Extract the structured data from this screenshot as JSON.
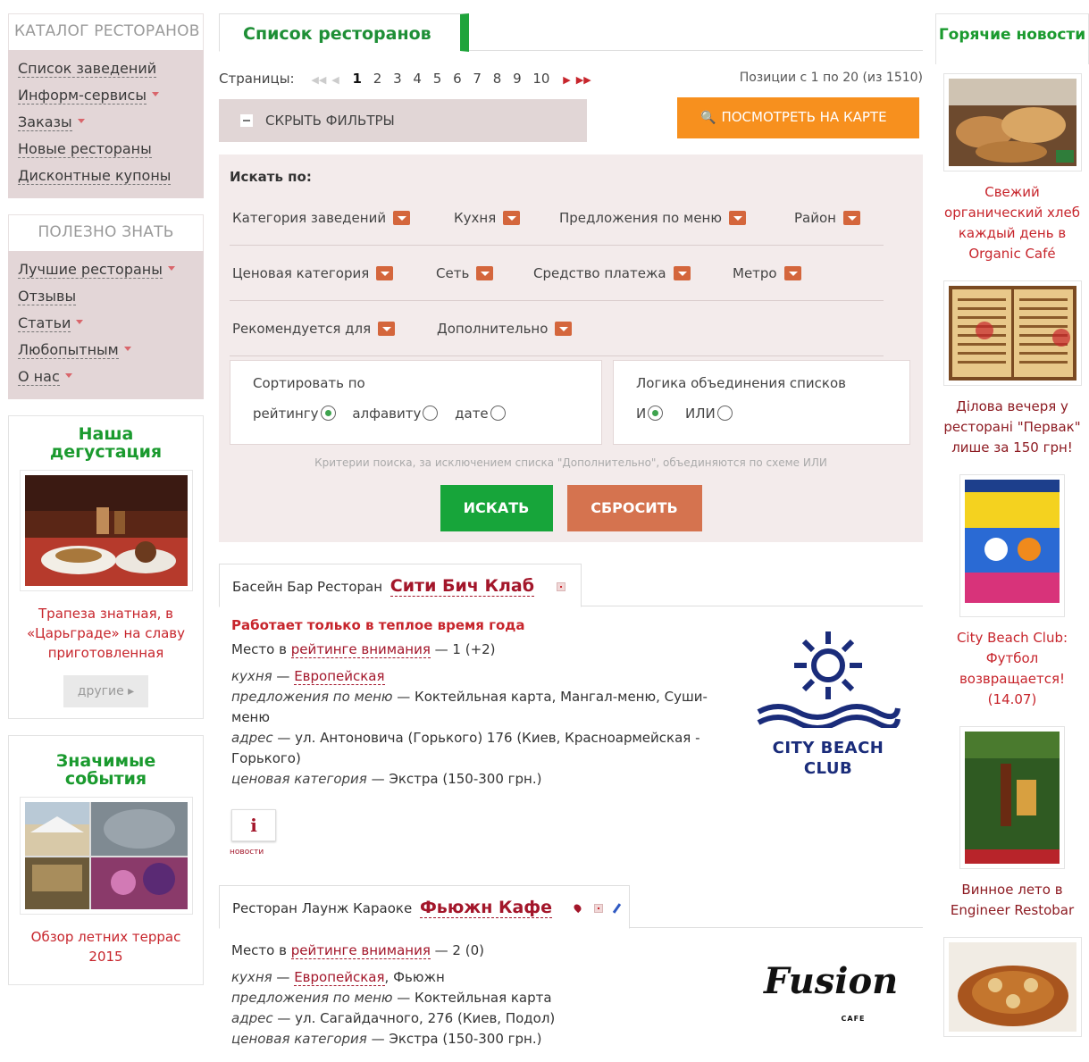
{
  "colors": {
    "accent_green": "#1fa43b",
    "brand_red": "#a3162a",
    "map_orange": "#f7901e",
    "reset_orange": "#d5734f",
    "menu_bg": "#e3d6d7"
  },
  "catalog": {
    "title": "КАТАЛОГ РЕСТОРАНОВ",
    "items": [
      {
        "label": "Список заведений",
        "has_menu": false
      },
      {
        "label": "Информ-сервисы",
        "has_menu": true
      },
      {
        "label": "Заказы",
        "has_menu": true
      },
      {
        "label": "Новые рестораны",
        "has_menu": false
      },
      {
        "label": "Дисконтные купоны",
        "has_menu": false
      }
    ]
  },
  "useful": {
    "title": "ПОЛЕЗНО ЗНАТЬ",
    "items": [
      {
        "label": "Лучшие рестораны",
        "has_menu": true
      },
      {
        "label": "Отзывы",
        "has_menu": false
      },
      {
        "label": "Статьи",
        "has_menu": true
      },
      {
        "label": "Любопытным",
        "has_menu": true
      },
      {
        "label": "О нас",
        "has_menu": true
      }
    ]
  },
  "tasting": {
    "title": "Наша дегустация",
    "caption": "Трапеза знатная, в «Царьграде» на славу приготовленная",
    "others_label": "другие"
  },
  "events": {
    "title": "Значимые события",
    "caption": "Обзор летних террас 2015"
  },
  "main": {
    "tab_title": "Список ресторанов",
    "pager": {
      "label": "Страницы:",
      "pages": [
        "1",
        "2",
        "3",
        "4",
        "5",
        "6",
        "7",
        "8",
        "9",
        "10"
      ],
      "current": "1",
      "positions": "Позиции с 1 по 20 (из 1510)"
    },
    "hide_filters_label": "СКРЫТЬ ФИЛЬТРЫ",
    "map_button_label": "ПОСМОТРЕТЬ НА КАРТЕ",
    "search_by_label": "Искать по:",
    "filter_rows": [
      [
        "Категория заведений",
        "Кухня",
        "Предложения по меню",
        "Район"
      ],
      [
        "Ценовая категория",
        "Сеть",
        "Средство платежа",
        "Метро"
      ],
      [
        "Рекомендуется для",
        "Дополнительно"
      ]
    ],
    "sort": {
      "title": "Сортировать по",
      "options": [
        {
          "label": "рейтингу",
          "selected": true
        },
        {
          "label": "алфавиту",
          "selected": false
        },
        {
          "label": "дате",
          "selected": false
        }
      ]
    },
    "logic": {
      "title": "Логика объединения списков",
      "options": [
        {
          "label": "И",
          "selected": true
        },
        {
          "label": "ИЛИ",
          "selected": false
        }
      ]
    },
    "criteria_note": "Критерии поиска, за исключением списка \"Дополнительно\", объединяются по схеме ИЛИ",
    "search_button": "ИСКАТЬ",
    "reset_button": "СБРОСИТЬ"
  },
  "listings": [
    {
      "type": "Басейн Бар Ресторан",
      "name": "Сити Бич Клаб",
      "notice": "Работает только в теплое время года",
      "rating_prefix": "Место в ",
      "rating_link": "рейтинге внимания",
      "rating_value": " — 1 (+2)",
      "cuisine_label": "кухня",
      "cuisine_link": "Европейская",
      "cuisine_rest": "",
      "menu_label": "предложения по меню",
      "menu_value": " — Коктейльная карта, Мангал-меню, Суши-меню",
      "address_label": "адрес",
      "address_value": " — ул. Антоновича (Горького) 176 (Киев, Красноармейская - Горького)",
      "price_label": "ценовая категория",
      "price_value": " — Экстра (150-300 грн.)",
      "logo_text": "CITY BEACH CLUB",
      "info_icon": "i",
      "info_label": "новости"
    },
    {
      "type": "Ресторан Лаунж Караоке",
      "name": "Фьюжн Кафе",
      "rating_prefix": "Место в ",
      "rating_link": "рейтинге внимания",
      "rating_value": " — 2 (0)",
      "cuisine_label": "кухня",
      "cuisine_link": "Европейская",
      "cuisine_rest": ", Фьюжн",
      "menu_label": "предложения по меню",
      "menu_value": " — Коктейльная карта",
      "address_label": "адрес",
      "address_value": " — ул. Сагайдачного, 276 (Киев, Подол)",
      "price_label": "ценовая категория",
      "price_value": " — Экстра (150-300 грн.)",
      "logo_text": "Fusion",
      "logo_sub": "CAFE"
    }
  ],
  "news": {
    "title": "Горячие новости",
    "items": [
      {
        "caption": "Свежий органический хлеб каждый день в Organic Café"
      },
      {
        "caption": "Ділова вечеря у ресторані \"Первак\" лише за 150 грн!"
      },
      {
        "caption": "City Beach Club: Футбол возвращается! (14.07)"
      },
      {
        "caption": "Винное лето в Engineer Restobar"
      }
    ]
  }
}
